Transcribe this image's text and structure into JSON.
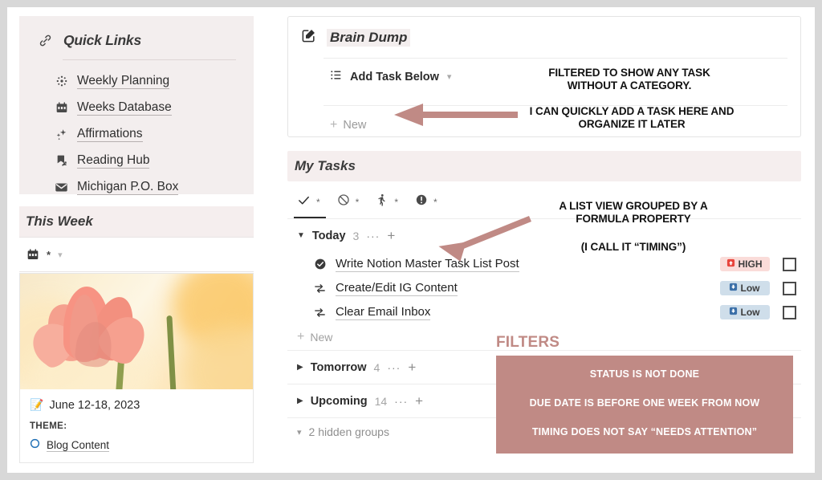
{
  "accent": {
    "rose": "#c08a85",
    "panel_pink": "#f3eeee",
    "badge_high_bg": "#fadcd9",
    "badge_low_bg": "#cfdeea"
  },
  "sidebar": {
    "quick_links": {
      "icon": "link-icon",
      "title": "Quick Links",
      "items": [
        {
          "icon": "asterisk-sparkle-icon",
          "label": "Weekly Planning"
        },
        {
          "icon": "calendar-icon",
          "label": "Weeks Database"
        },
        {
          "icon": "sparkles-icon",
          "label": "Affirmations"
        },
        {
          "icon": "bookmark-arrow-icon",
          "label": "Reading Hub"
        },
        {
          "icon": "envelope-icon",
          "label": "Michigan P.O. Box"
        }
      ]
    },
    "this_week": {
      "title": "This Week",
      "toolbar": {
        "icon": "calendar-icon",
        "star": "*",
        "chevron": "chevron-down-icon"
      },
      "card": {
        "date_emoji": "memo-icon",
        "date": "June 12-18, 2023",
        "theme_label": "THEME:",
        "theme_value": "Blog Content",
        "theme_bullet": "circle-outline-icon"
      }
    }
  },
  "brain_dump": {
    "icon": "edit-square-icon",
    "title": "Brain Dump",
    "add_task_row": {
      "icon": "list-icon",
      "label": "Add Task Below",
      "chevron": "chevron-down-icon"
    },
    "new_row": {
      "plus": "+",
      "label": "New"
    }
  },
  "my_tasks": {
    "title": "My Tasks",
    "tabs": [
      {
        "icon": "check-icon",
        "star": "*",
        "active": true
      },
      {
        "icon": "no-entry-icon",
        "star": "*",
        "active": false
      },
      {
        "icon": "person-walking-icon",
        "star": "*",
        "active": false
      },
      {
        "icon": "exclamation-circle-icon",
        "star": "*",
        "active": false
      }
    ],
    "groups": [
      {
        "name": "Today",
        "count": "3",
        "caret": "caret-down-icon",
        "dots": "···",
        "plus": "+",
        "expanded": true,
        "tasks": [
          {
            "status_icon": "check-circle-filled-icon",
            "name": "Write Notion Master Task List Post",
            "priority": "HIGH",
            "priority_level": "high",
            "priority_icon": "up-arrow-red-icon"
          },
          {
            "status_icon": "recurring-icon",
            "name": "Create/Edit IG Content",
            "priority": "Low",
            "priority_level": "low",
            "priority_icon": "down-arrow-blue-icon"
          },
          {
            "status_icon": "recurring-icon",
            "name": "Clear Email Inbox",
            "priority": "Low",
            "priority_level": "low",
            "priority_icon": "down-arrow-blue-icon"
          }
        ],
        "new_label": "New"
      },
      {
        "name": "Tomorrow",
        "count": "4",
        "caret": "caret-right-icon",
        "dots": "···",
        "plus": "+",
        "expanded": false,
        "tasks": []
      },
      {
        "name": "Upcoming",
        "count": "14",
        "caret": "caret-right-icon",
        "dots": "···",
        "plus": "+",
        "expanded": false,
        "tasks": []
      }
    ],
    "hidden_groups": {
      "caret": "chevron-down-icon",
      "label": "2 hidden groups"
    }
  },
  "annotations": {
    "filtered_note_line1": "FILTERED TO SHOW ANY TASK",
    "filtered_note_line2": "WITHOUT A CATEGORY.",
    "quick_add_line1": "I CAN QUICKLY ADD A TASK HERE AND",
    "quick_add_line2": "ORGANIZE IT LATER",
    "list_view_line1": "A LIST VIEW GROUPED BY A",
    "list_view_line2": "FORMULA PROPERTY",
    "timing_note": "(I CALL IT “TIMING”)",
    "filters_title": "FILTERS",
    "filters": [
      "STATUS IS NOT DONE",
      "DUE DATE IS BEFORE ONE WEEK FROM NOW",
      "TIMING DOES NOT SAY “NEEDS ATTENTION”"
    ]
  }
}
